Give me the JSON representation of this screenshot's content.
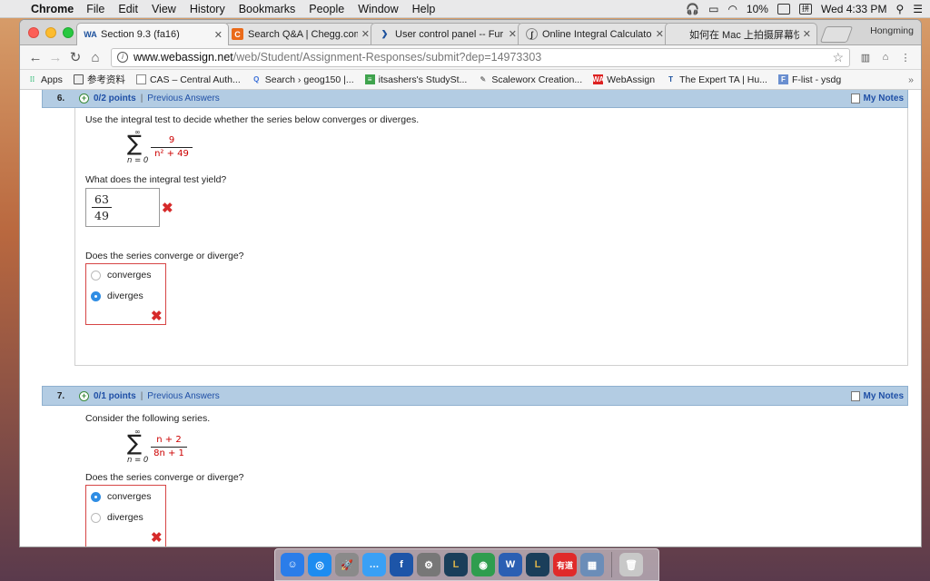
{
  "menubar": {
    "app_name": "Chrome",
    "menus": [
      "File",
      "Edit",
      "View",
      "History",
      "Bookmarks",
      "People",
      "Window",
      "Help"
    ],
    "battery": "10%",
    "clock": "Wed 4:33 PM"
  },
  "tabs": [
    {
      "title": "Section 9.3 (fa16)",
      "favicon": "WA",
      "active": true
    },
    {
      "title": "Search Q&A | Chegg.com",
      "favicon": "C"
    },
    {
      "title": "User control panel -- Fur Af",
      "favicon": "user-icon"
    },
    {
      "title": "Online Integral Calculator -",
      "favicon": "calc-icon"
    },
    {
      "title": "如何在 Mac 上拍摄屏幕快照",
      "favicon": "apple-icon"
    }
  ],
  "profile_name": "Hongming",
  "address": {
    "host": "www.webassign.net",
    "path": "/web/Student/Assignment-Responses/submit?dep=14973303"
  },
  "bookmarks": [
    {
      "label": "Apps",
      "icon": "apps-grid-icon"
    },
    {
      "label": "参考资料",
      "icon": "folder-icon"
    },
    {
      "label": "CAS – Central Auth...",
      "icon": "page-icon"
    },
    {
      "label": "Search › geog150 |...",
      "icon": "q-icon"
    },
    {
      "label": "itsashers's StudySt...",
      "icon": "studystack-icon"
    },
    {
      "label": "Scaleworx Creation...",
      "icon": "pen-icon"
    },
    {
      "label": "WebAssign",
      "icon": "webassign-icon"
    },
    {
      "label": "The Expert TA | Hu...",
      "icon": "expert-ta-icon"
    },
    {
      "label": "F-list - ysdg",
      "icon": "flist-icon"
    }
  ],
  "bookmarks_more": "»",
  "questions": [
    {
      "number": "6.",
      "points": "0/2 points",
      "previous": "Previous Answers",
      "notes": "My Notes",
      "prompt": "Use the integral test to decide whether the series below converges or diverges.",
      "series": {
        "upper": "∞",
        "lower": "n = 0",
        "numerator": "9",
        "denominator": "n² + 49"
      },
      "sub_prompt": "What does the integral test yield?",
      "answer": {
        "numerator": "63",
        "denominator": "49"
      },
      "converge_prompt": "Does the series converge or diverge?",
      "choices": [
        {
          "label": "converges",
          "selected": false
        },
        {
          "label": "diverges",
          "selected": true
        }
      ],
      "mark": "✖"
    },
    {
      "number": "7.",
      "points": "0/1 points",
      "previous": "Previous Answers",
      "notes": "My Notes",
      "prompt": "Consider the following series.",
      "series": {
        "upper": "∞",
        "lower": "n = 0",
        "numerator": "n + 2",
        "denominator": "8n + 1"
      },
      "converge_prompt": "Does the series converge or diverge?",
      "choices": [
        {
          "label": "converges",
          "selected": true
        },
        {
          "label": "diverges",
          "selected": false
        }
      ],
      "mark": "✖"
    }
  ],
  "dock": [
    {
      "name": "finder-icon",
      "glyph": "☺",
      "color": "#2b7de9"
    },
    {
      "name": "safari-icon",
      "glyph": "◎",
      "color": "#1d8cf0"
    },
    {
      "name": "launchpad-icon",
      "glyph": "🚀",
      "color": "#8a8a8a"
    },
    {
      "name": "messages-icon",
      "glyph": "…",
      "color": "#3aa0f5"
    },
    {
      "name": "facebook-icon",
      "glyph": "f",
      "color": "#1d55a8"
    },
    {
      "name": "settings-icon",
      "glyph": "⚙",
      "color": "#777"
    },
    {
      "name": "league-icon",
      "glyph": "L",
      "color": "#1a3e5a"
    },
    {
      "name": "chrome-icon",
      "glyph": "◉",
      "color": "#2f9d4e"
    },
    {
      "name": "word-icon",
      "glyph": "W",
      "color": "#2b5fb3"
    },
    {
      "name": "league2-icon",
      "glyph": "L",
      "color": "#1a3e5a"
    },
    {
      "name": "youdao-icon",
      "glyph": "有道",
      "color": "#e02a2a"
    },
    {
      "name": "preview-icon",
      "glyph": "▦",
      "color": "#6b8db8"
    },
    {
      "name": "trash-icon",
      "glyph": "🗑",
      "color": "#c8c8c8"
    }
  ]
}
